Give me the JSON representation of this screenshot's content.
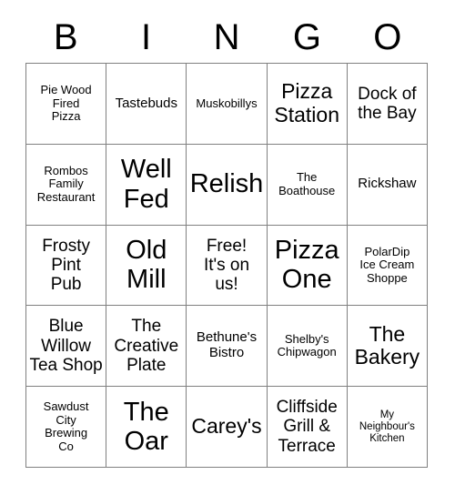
{
  "card": {
    "title": "BINGO",
    "header_letters": [
      "B",
      "I",
      "N",
      "G",
      "O"
    ],
    "columns": 5,
    "rows": 5,
    "grid_color": "#808080",
    "text_color": "#000000",
    "background_color": "#ffffff",
    "free_space": {
      "row": 3,
      "column": 3,
      "label": "Free!\nIt's on\nus!"
    }
  },
  "cells": [
    {
      "id": "b1",
      "column": "B",
      "row": 1,
      "text": "Pie Wood\nFired\nPizza",
      "size": "sm"
    },
    {
      "id": "i1",
      "column": "I",
      "row": 1,
      "text": "Tastebuds",
      "size": "md"
    },
    {
      "id": "n1",
      "column": "N",
      "row": 1,
      "text": "Muskobillys",
      "size": "sm"
    },
    {
      "id": "g1",
      "column": "G",
      "row": 1,
      "text": "Pizza\nStation",
      "size": "xl"
    },
    {
      "id": "o1",
      "column": "O",
      "row": 1,
      "text": "Dock of\nthe Bay",
      "size": "lg"
    },
    {
      "id": "b2",
      "column": "B",
      "row": 2,
      "text": "Rombos\nFamily\nRestaurant",
      "size": "sm"
    },
    {
      "id": "i2",
      "column": "I",
      "row": 2,
      "text": "Well\nFed",
      "size": "xxl"
    },
    {
      "id": "n2",
      "column": "N",
      "row": 2,
      "text": "Relish",
      "size": "xxl"
    },
    {
      "id": "g2",
      "column": "G",
      "row": 2,
      "text": "The\nBoathouse",
      "size": "sm"
    },
    {
      "id": "o2",
      "column": "O",
      "row": 2,
      "text": "Rickshaw",
      "size": "md"
    },
    {
      "id": "b3",
      "column": "B",
      "row": 3,
      "text": "Frosty\nPint\nPub",
      "size": "lg"
    },
    {
      "id": "i3",
      "column": "I",
      "row": 3,
      "text": "Old\nMill",
      "size": "xxl"
    },
    {
      "id": "n3",
      "column": "N",
      "row": 3,
      "text": "Free!\nIt's on\nus!",
      "size": "lg"
    },
    {
      "id": "g3",
      "column": "G",
      "row": 3,
      "text": "Pizza\nOne",
      "size": "xxl"
    },
    {
      "id": "o3",
      "column": "O",
      "row": 3,
      "text": "PolarDip\nIce Cream\nShoppe",
      "size": "sm"
    },
    {
      "id": "b4",
      "column": "B",
      "row": 4,
      "text": "Blue\nWillow\nTea Shop",
      "size": "lg"
    },
    {
      "id": "i4",
      "column": "I",
      "row": 4,
      "text": "The\nCreative\nPlate",
      "size": "lg"
    },
    {
      "id": "n4",
      "column": "N",
      "row": 4,
      "text": "Bethune's\nBistro",
      "size": "md"
    },
    {
      "id": "g4",
      "column": "G",
      "row": 4,
      "text": "Shelby's\nChipwagon",
      "size": "sm"
    },
    {
      "id": "o4",
      "column": "O",
      "row": 4,
      "text": "The\nBakery",
      "size": "xl"
    },
    {
      "id": "b5",
      "column": "B",
      "row": 5,
      "text": "Sawdust\nCity\nBrewing\nCo",
      "size": "sm"
    },
    {
      "id": "i5",
      "column": "I",
      "row": 5,
      "text": "The\nOar",
      "size": "xxl"
    },
    {
      "id": "n5",
      "column": "N",
      "row": 5,
      "text": "Carey's",
      "size": "xl"
    },
    {
      "id": "g5",
      "column": "G",
      "row": 5,
      "text": "Cliffside\nGrill &\nTerrace",
      "size": "lg"
    },
    {
      "id": "o5",
      "column": "O",
      "row": 5,
      "text": "My\nNeighbour's\nKitchen",
      "size": "xs"
    }
  ]
}
